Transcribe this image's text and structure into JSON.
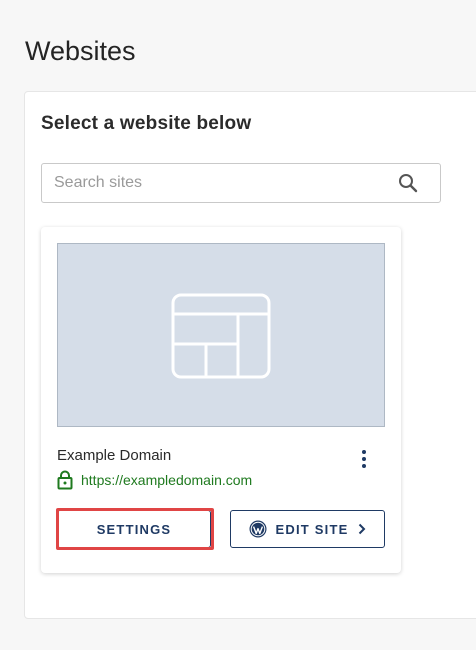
{
  "page": {
    "title": "Websites"
  },
  "panel": {
    "heading": "Select a website below",
    "search": {
      "placeholder": "Search sites",
      "value": "",
      "icon": "search-icon"
    }
  },
  "site_card": {
    "name": "Example Domain",
    "url": "https://exampledomain.com",
    "thumbnail_icon": "layout-placeholder-icon",
    "lock_icon": "lock-icon",
    "menu_icon": "kebab-menu-icon",
    "buttons": {
      "settings_label": "SETTINGS",
      "edit_site_label": "EDIT SITE",
      "edit_site_icon": "wordpress-icon"
    }
  },
  "colors": {
    "primary": "#1f3a64",
    "secure_url": "#1f7a1f",
    "highlight": "#e04545",
    "thumbnail_bg": "#d5dde8"
  }
}
